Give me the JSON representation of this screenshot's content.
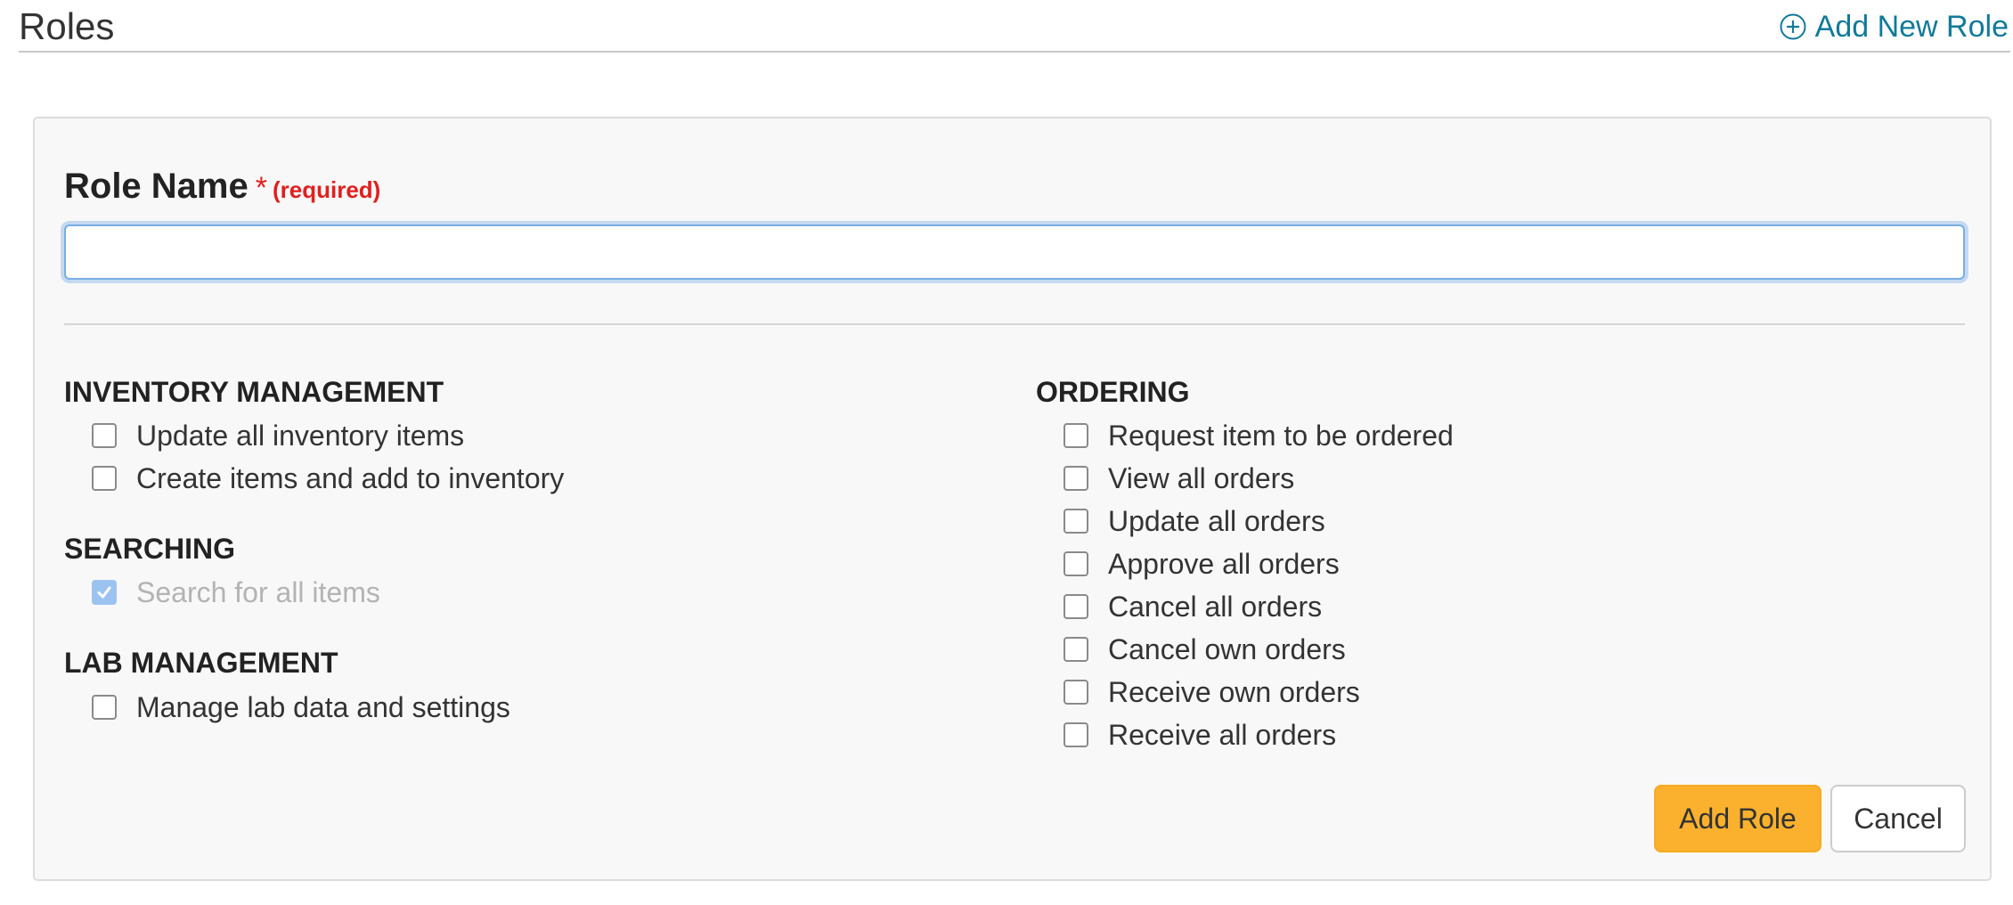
{
  "header": {
    "title": "Roles",
    "add_new_role_label": "Add New Role"
  },
  "form": {
    "role_name_label": "Role Name",
    "required_star": "*",
    "required_text": "(required)",
    "role_name_value": "",
    "role_name_placeholder": ""
  },
  "sections": {
    "inventory": {
      "heading": "INVENTORY MANAGEMENT",
      "items": [
        {
          "label": "Update all inventory items",
          "checked": false,
          "disabled": false
        },
        {
          "label": "Create items and add to inventory",
          "checked": false,
          "disabled": false
        }
      ]
    },
    "searching": {
      "heading": "SEARCHING",
      "items": [
        {
          "label": "Search for all items",
          "checked": true,
          "disabled": true
        }
      ]
    },
    "lab": {
      "heading": "LAB MANAGEMENT",
      "items": [
        {
          "label": "Manage lab data and settings",
          "checked": false,
          "disabled": false
        }
      ]
    },
    "ordering": {
      "heading": "ORDERING",
      "items": [
        {
          "label": "Request item to be ordered",
          "checked": false,
          "disabled": false
        },
        {
          "label": "View all orders",
          "checked": false,
          "disabled": false
        },
        {
          "label": "Update all orders",
          "checked": false,
          "disabled": false
        },
        {
          "label": "Approve all orders",
          "checked": false,
          "disabled": false
        },
        {
          "label": "Cancel all orders",
          "checked": false,
          "disabled": false
        },
        {
          "label": "Cancel own orders",
          "checked": false,
          "disabled": false
        },
        {
          "label": "Receive own orders",
          "checked": false,
          "disabled": false
        },
        {
          "label": "Receive all orders",
          "checked": false,
          "disabled": false
        }
      ]
    }
  },
  "actions": {
    "add_role_label": "Add Role",
    "cancel_label": "Cancel"
  },
  "colors": {
    "link": "#117a99",
    "required": "#e0201f",
    "primary_button": "#fbb12d",
    "checked_disabled": "#9cc3f0"
  }
}
